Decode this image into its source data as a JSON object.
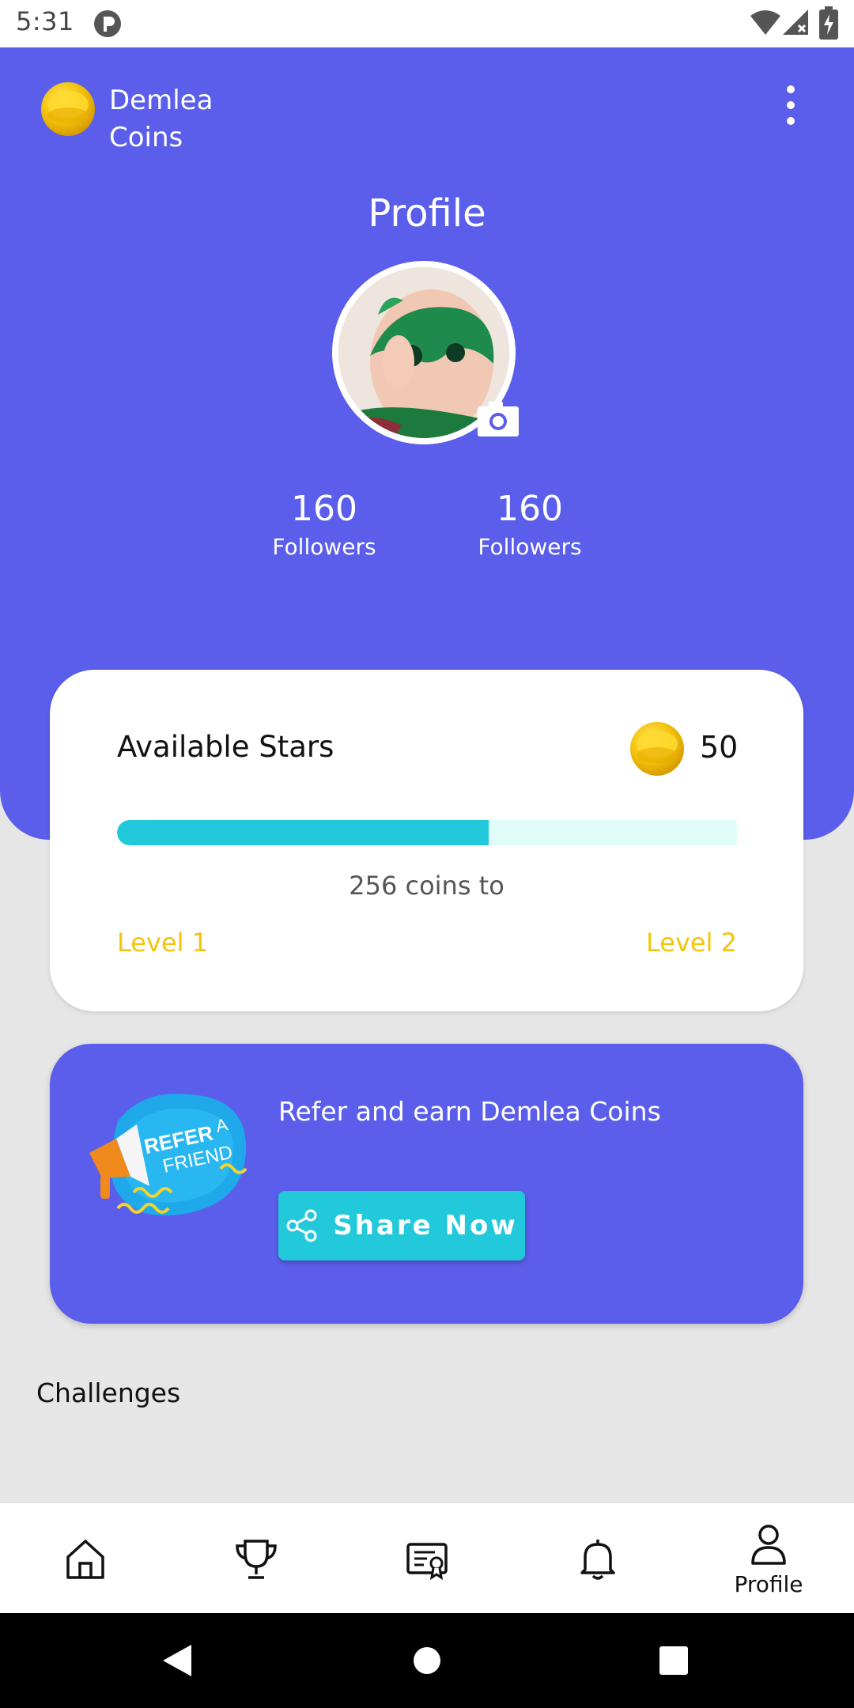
{
  "status_bar": {
    "time": "5:31"
  },
  "header": {
    "brand_name": "Demlea\nCoins",
    "title": "Profile",
    "stats": [
      {
        "value": "160",
        "label": "Followers"
      },
      {
        "value": "160",
        "label": "Followers"
      }
    ]
  },
  "stars_card": {
    "title": "Available Stars",
    "value": "50",
    "progress_fraction": 0.6,
    "caption": "256 coins to",
    "level_from": "Level 1",
    "level_to": "Level 2"
  },
  "refer_card": {
    "illustration_text_1": "REFER",
    "illustration_text_2": "A",
    "illustration_text_3": "FRIEND",
    "text": "Refer and earn Demlea Coins",
    "button_label": "Share Now"
  },
  "section": {
    "challenges_title": "Challenges"
  },
  "bottom_nav": {
    "items": [
      {
        "icon": "home-icon",
        "label": ""
      },
      {
        "icon": "trophy-icon",
        "label": ""
      },
      {
        "icon": "certificate-icon",
        "label": ""
      },
      {
        "icon": "bell-icon",
        "label": ""
      },
      {
        "icon": "user-icon",
        "label": "Profile"
      }
    ]
  },
  "colors": {
    "primary": "#5b5eea",
    "accent": "#22c9da",
    "level": "#f4c40a",
    "coin": "#f2c40c"
  }
}
